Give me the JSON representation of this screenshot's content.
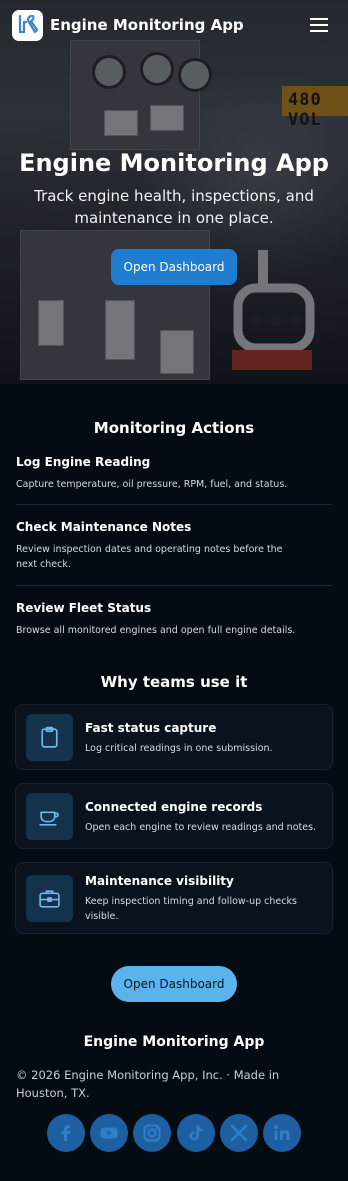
{
  "navbar": {
    "brand": "Engine Monitoring App",
    "logo_icon": "wrench-logo-icon",
    "menu_icon": "hamburger-menu-icon"
  },
  "hero": {
    "title": "Engine Monitoring App",
    "subtitle": "Track engine health, inspections, and maintenance in one place.",
    "button_label": "Open Dashboard",
    "sign_text": "480 VOL"
  },
  "actions": {
    "title": "Monitoring Actions",
    "items": [
      {
        "title": "Log Engine Reading",
        "desc": "Capture temperature, oil pressure, RPM, fuel, and status."
      },
      {
        "title": "Check Maintenance Notes",
        "desc": "Review inspection dates and operating notes before the next check."
      },
      {
        "title": "Review Fleet Status",
        "desc": "Browse all monitored engines and open full engine details."
      }
    ]
  },
  "benefits": {
    "title": "Why teams use it",
    "items": [
      {
        "title": "Fast status capture",
        "desc": "Log critical readings in one submission.",
        "icon": "clipboard-icon"
      },
      {
        "title": "Connected engine records",
        "desc": "Open each engine to review readings and notes.",
        "icon": "cup-icon"
      },
      {
        "title": "Maintenance visibility",
        "desc": "Keep inspection timing and follow-up checks visible.",
        "icon": "toolbox-icon"
      }
    ]
  },
  "cta": {
    "button_label": "Open Dashboard"
  },
  "footer": {
    "title": "Engine Monitoring App",
    "copyright": "© 2026 Engine Monitoring App, Inc. · Made in Houston, TX.",
    "social": [
      "facebook-icon",
      "youtube-icon",
      "instagram-icon",
      "tiktok-icon",
      "x-icon",
      "linkedin-icon"
    ]
  },
  "colors": {
    "accent": "#1f7dd0",
    "cta": "#5ab3ea",
    "background": "#050b12",
    "social": "#1d5fa0"
  }
}
